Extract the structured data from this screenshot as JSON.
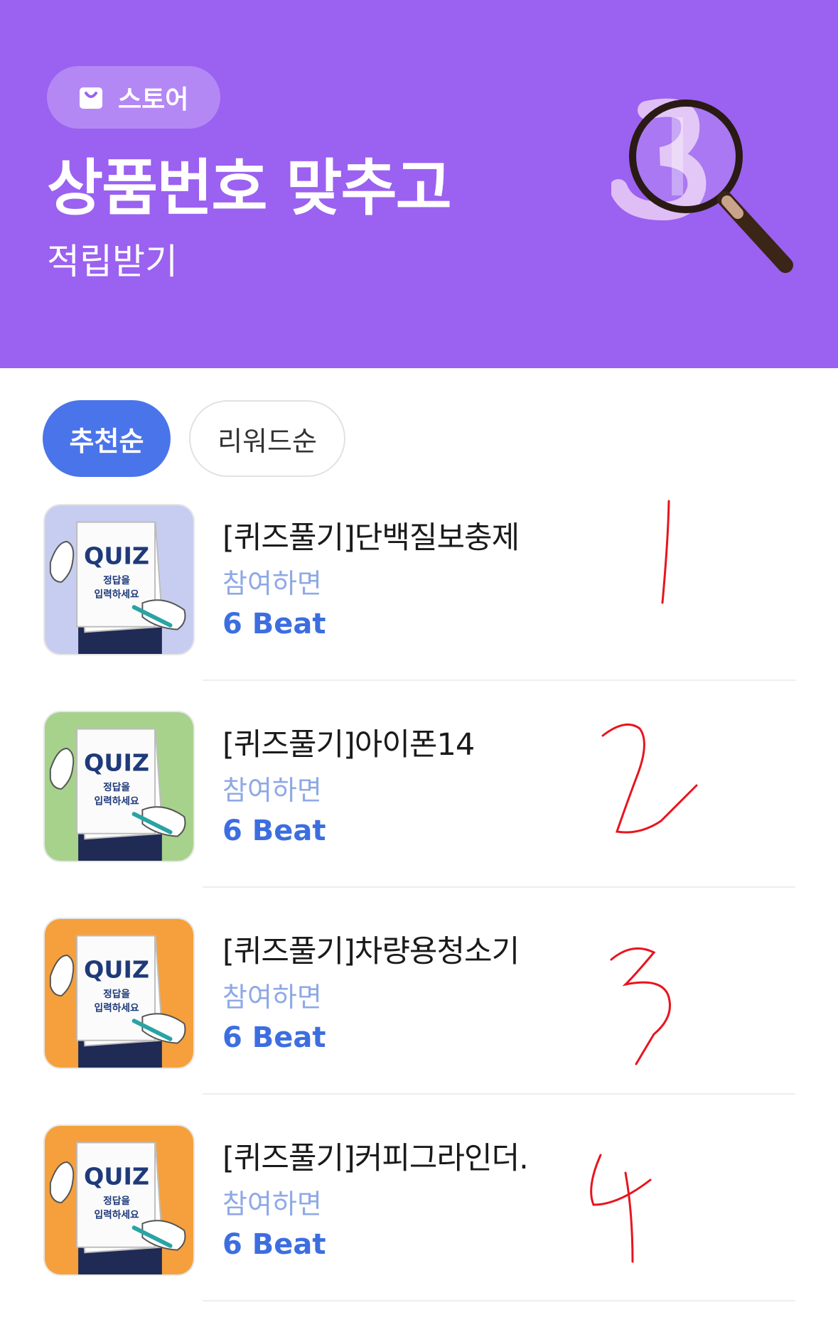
{
  "banner": {
    "chip_label": "스토어",
    "title": "상품번호 맞추고",
    "subtitle": "적립받기",
    "bg_color": "#9b61f0"
  },
  "sort": {
    "options": [
      {
        "label": "추천순",
        "active": true
      },
      {
        "label": "리워드순",
        "active": false
      }
    ]
  },
  "items": [
    {
      "title": "[퀴즈풀기]단백질보충제",
      "subtitle": "참여하면",
      "reward": "6 Beat",
      "thumb_bg": "#c7cdf0",
      "annotation": "1"
    },
    {
      "title": "[퀴즈풀기]아이폰14",
      "subtitle": "참여하면",
      "reward": "6 Beat",
      "thumb_bg": "#a6d28c",
      "annotation": "2"
    },
    {
      "title": "[퀴즈풀기]차량용청소기",
      "subtitle": "참여하면",
      "reward": "6 Beat",
      "thumb_bg": "#f5a03c",
      "annotation": "3"
    },
    {
      "title": "[퀴즈풀기]커피그라인더.",
      "subtitle": "참여하면",
      "reward": "6 Beat",
      "thumb_bg": "#f5a03c",
      "annotation": "4"
    }
  ],
  "thumb_text": {
    "quiz": "QUIZ",
    "line1": "정답을",
    "line2": "입력하세요"
  },
  "colors": {
    "accent": "#4a74ea",
    "reward": "#3d6ee0",
    "subtitle": "#8fa9e6",
    "annotation": "#e8141e"
  }
}
